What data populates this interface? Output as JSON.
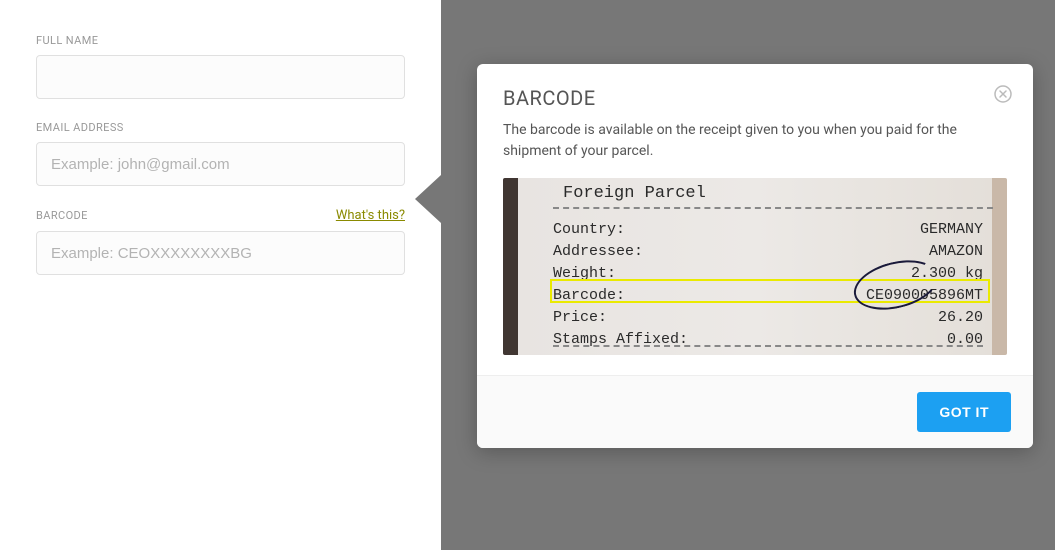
{
  "form": {
    "fullname_label": "FULL NAME",
    "email_label": "EMAIL ADDRESS",
    "email_placeholder": "Example: john@gmail.com",
    "barcode_label": "BARCODE",
    "barcode_placeholder": "Example: CEOXXXXXXXXBG",
    "whats_this": "What's this?"
  },
  "modal": {
    "title": "BARCODE",
    "description": "The barcode is available on the receipt given to you when you paid for the shipment of your parcel.",
    "got_it": "GOT IT"
  },
  "receipt": {
    "title": "Foreign Parcel",
    "lines": [
      {
        "label": "Country:",
        "value": "GERMANY"
      },
      {
        "label": "Addressee:",
        "value": "AMAZON"
      },
      {
        "label": "Weight:",
        "value": "2.300 kg"
      },
      {
        "label": "Barcode:",
        "value": "CE090005896MT"
      },
      {
        "label": "Price:",
        "value": "26.20"
      },
      {
        "label": "Stamps Affixed:",
        "value": "0.00"
      }
    ]
  }
}
